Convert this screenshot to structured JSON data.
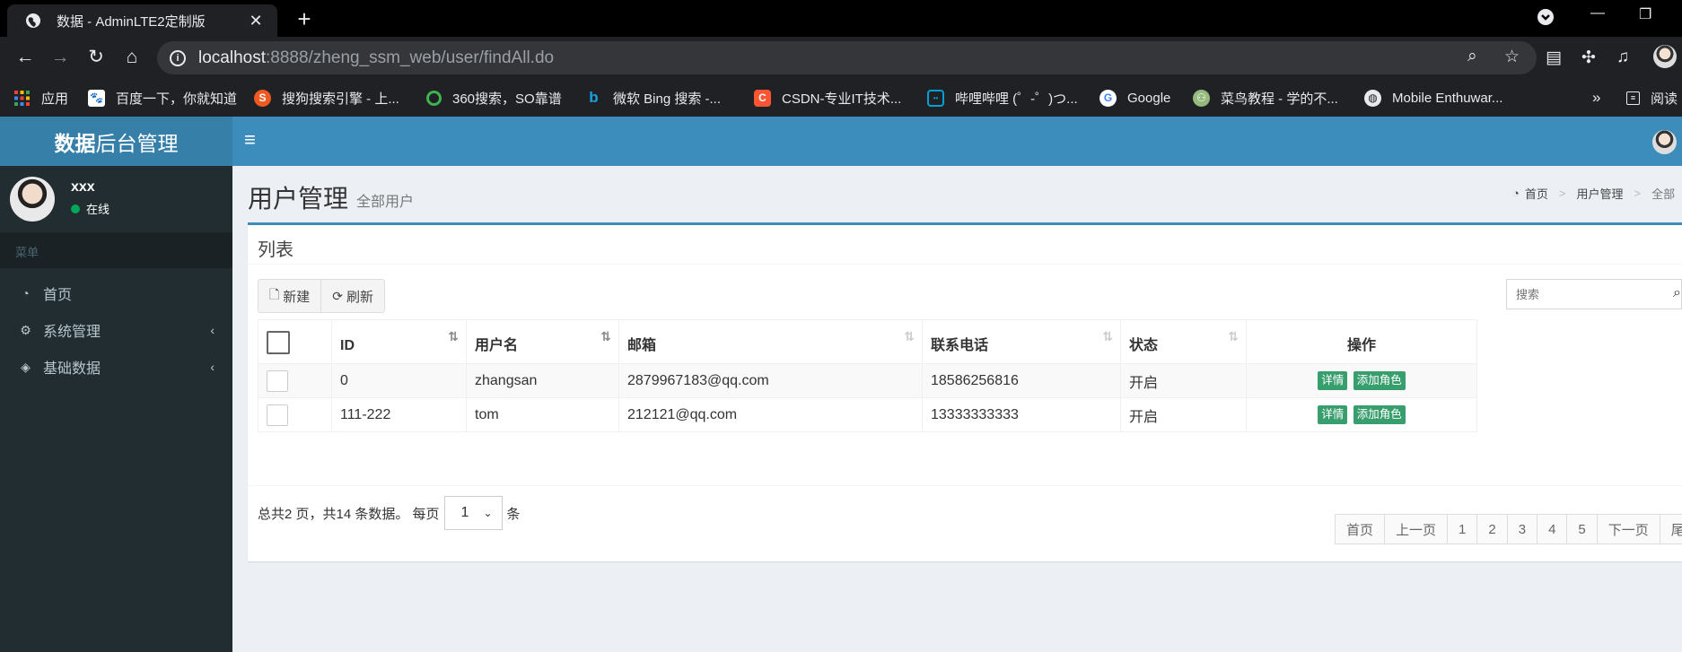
{
  "browser": {
    "tab_title": "数据 - AdminLTE2定制版",
    "url_host": "localhost",
    "url_rest": ":8888/zheng_ssm_web/user/findAll.do",
    "bookmarks": [
      {
        "label": "应用",
        "icon": "apps-grid-icon",
        "color": "#e8453c"
      },
      {
        "label": "百度一下，你就知道",
        "icon": "baidu-icon",
        "color": "#2932e1"
      },
      {
        "label": "搜狗搜索引擎 - 上...",
        "icon": "sogou-icon",
        "color": "#f05a22"
      },
      {
        "label": "360搜索，SO靠谱",
        "icon": "360-icon",
        "color": "#3fb34f"
      },
      {
        "label": "微软 Bing 搜索 -...",
        "icon": "bing-icon",
        "color": "#1ba1e2"
      },
      {
        "label": "CSDN-专业IT技术...",
        "icon": "csdn-icon",
        "color": "#fc5531"
      },
      {
        "label": "哔哩哔哩 (゜-゜)つ...",
        "icon": "bilibili-icon",
        "color": "#00a1d6"
      },
      {
        "label": "Google",
        "icon": "google-icon",
        "color": "#4285f4"
      },
      {
        "label": "菜鸟教程 - 学的不...",
        "icon": "runoob-icon",
        "color": "#96b97d"
      },
      {
        "label": "Mobile Enthuwar...",
        "icon": "globe-icon",
        "color": "#9aa0a6"
      }
    ],
    "more": "»",
    "reading_list": "阅读"
  },
  "app": {
    "logo_bold": "数据",
    "logo_rest": "后台管理",
    "user": {
      "name": "xxx",
      "status": "在线"
    },
    "menu_header": "菜单",
    "menu": [
      {
        "label": "首页",
        "icon": "dashboard-icon",
        "has_caret": false
      },
      {
        "label": "系统管理",
        "icon": "cogs-icon",
        "has_caret": true
      },
      {
        "label": "基础数据",
        "icon": "cube-icon",
        "has_caret": true
      }
    ],
    "page_title": "用户管理",
    "page_subtitle": "全部用户",
    "breadcrumb": [
      "首页",
      "用户管理",
      "全部"
    ],
    "box_title": "列表",
    "buttons": {
      "new": "新建",
      "refresh": "刷新"
    },
    "search_placeholder": "搜索",
    "table": {
      "headers": [
        "ID",
        "用户名",
        "邮箱",
        "联系电话",
        "状态",
        "操作"
      ],
      "rows": [
        {
          "id": "0",
          "username": "zhangsan",
          "email": "2879967183@qq.com",
          "phone": "18586256816",
          "status": "开启"
        },
        {
          "id": "111-222",
          "username": "tom",
          "email": "212121@qq.com",
          "phone": "13333333333",
          "status": "开启"
        }
      ],
      "op_detail": "详情",
      "op_add_role": "添加角色"
    },
    "pageinfo": {
      "prefix": "总共2 页，共14 条数据。 每页",
      "page_size": "1",
      "suffix": "条"
    },
    "pagination": [
      "首页",
      "上一页",
      "1",
      "2",
      "3",
      "4",
      "5",
      "下一页",
      "尾页"
    ]
  }
}
